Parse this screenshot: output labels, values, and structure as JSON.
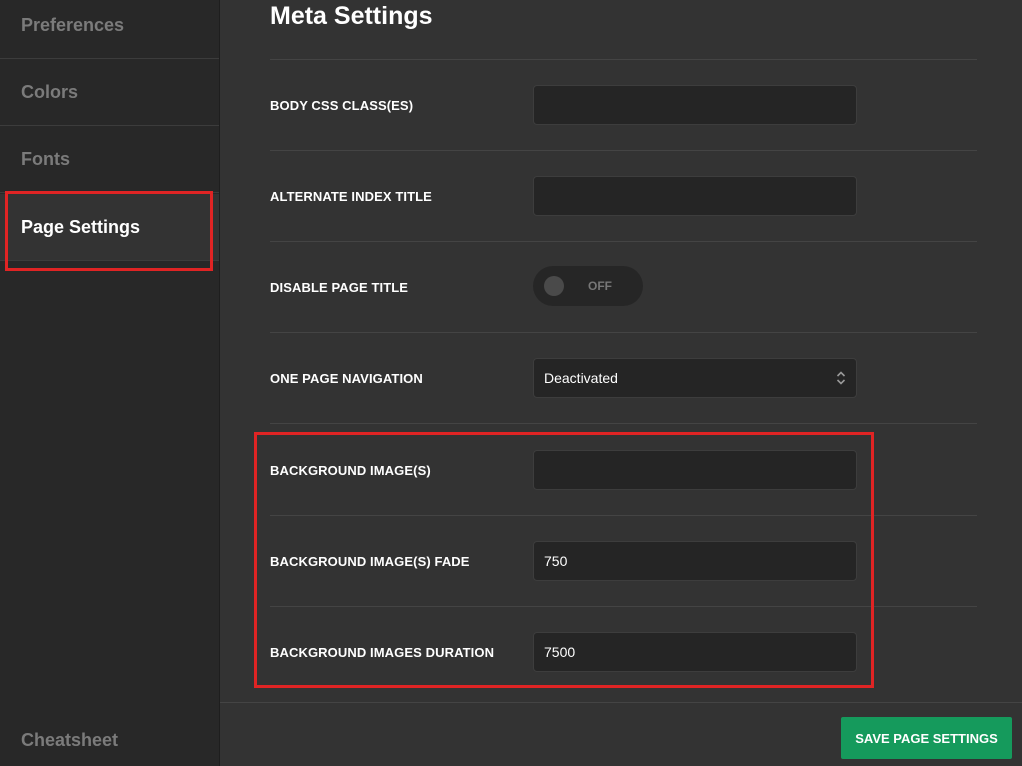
{
  "sidebar": {
    "items": [
      {
        "label": "Preferences",
        "active": false
      },
      {
        "label": "Colors",
        "active": false
      },
      {
        "label": "Fonts",
        "active": false
      },
      {
        "label": "Page Settings",
        "active": true
      }
    ],
    "bottom_item": "Cheatsheet"
  },
  "main": {
    "title": "Meta Settings",
    "fields": {
      "body_css": {
        "label": "BODY CSS CLASS(ES)",
        "value": ""
      },
      "alt_index_title": {
        "label": "ALTERNATE INDEX TITLE",
        "value": ""
      },
      "disable_page_title": {
        "label": "DISABLE PAGE TITLE",
        "state": "OFF"
      },
      "one_page_nav": {
        "label": "ONE PAGE NAVIGATION",
        "selected": "Deactivated"
      },
      "bg_images": {
        "label": "BACKGROUND IMAGE(S)",
        "value": ""
      },
      "bg_fade": {
        "label": "BACKGROUND IMAGE(S) FADE",
        "value": "750"
      },
      "bg_duration": {
        "label": "BACKGROUND IMAGES DURATION",
        "value": "7500"
      }
    },
    "save_label": "SAVE PAGE SETTINGS"
  },
  "colors": {
    "accent": "#159a5c",
    "highlight": "#e02424",
    "background": "#333333",
    "sidebar": "#282828"
  }
}
